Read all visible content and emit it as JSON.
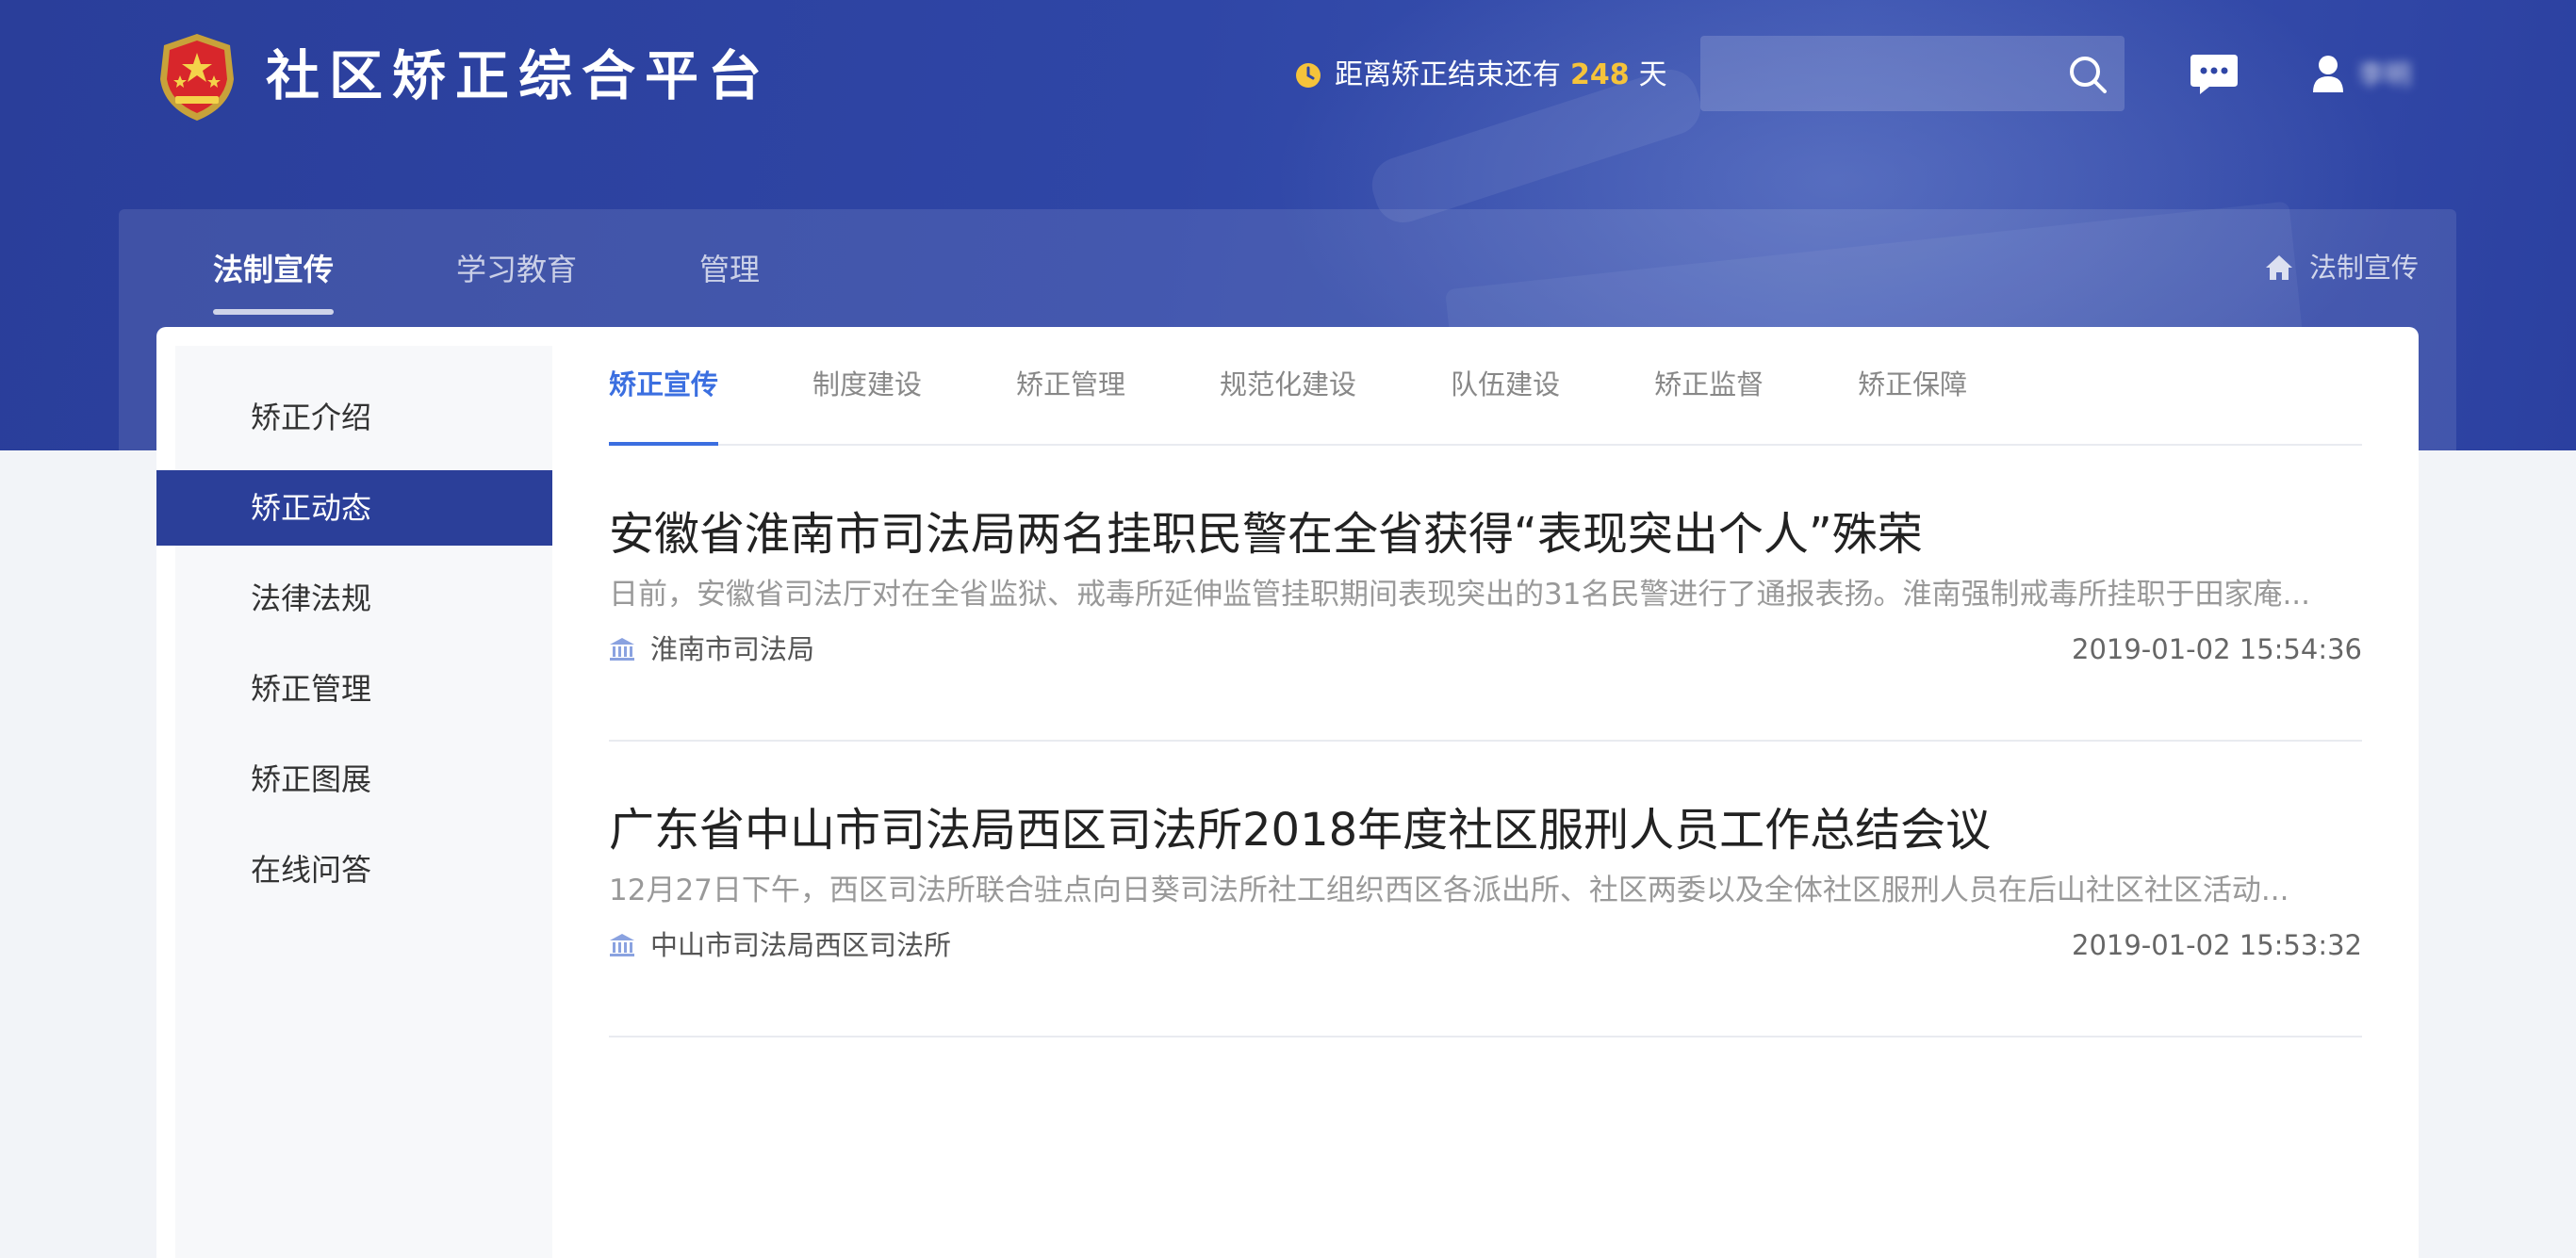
{
  "header": {
    "site_title": "社区矫正综合平台",
    "countdown_prefix": "距离矫正结束还有",
    "countdown_days": "248",
    "countdown_suffix": "天",
    "search_placeholder": "",
    "user_name": "李明"
  },
  "top_nav": [
    {
      "label": "法制宣传",
      "active": true
    },
    {
      "label": "学习教育",
      "active": false
    },
    {
      "label": "管理",
      "active": false
    }
  ],
  "breadcrumb": {
    "current": "法制宣传"
  },
  "sidebar": {
    "items": [
      {
        "label": "矫正介绍",
        "active": false
      },
      {
        "label": "矫正动态",
        "active": true
      },
      {
        "label": "法律法规",
        "active": false
      },
      {
        "label": "矫正管理",
        "active": false
      },
      {
        "label": "矫正图展",
        "active": false
      },
      {
        "label": "在线问答",
        "active": false
      }
    ]
  },
  "sub_tabs": [
    {
      "label": "矫正宣传",
      "active": true
    },
    {
      "label": "制度建设",
      "active": false
    },
    {
      "label": "矫正管理",
      "active": false
    },
    {
      "label": "规范化建设",
      "active": false
    },
    {
      "label": "队伍建设",
      "active": false
    },
    {
      "label": "矫正监督",
      "active": false
    },
    {
      "label": "矫正保障",
      "active": false
    }
  ],
  "articles": [
    {
      "title": "安徽省淮南市司法局两名挂职民警在全省获得“表现突出个人”殊荣",
      "summary": "日前，安徽省司法厅对在全省监狱、戒毒所延伸监管挂职期间表现突出的31名民警进行了通报表扬。淮南强制戒毒所挂职于田家庵...",
      "source": "淮南市司法局",
      "time": "2019-01-02 15:54:36"
    },
    {
      "title": "广东省中山市司法局西区司法所2018年度社区服刑人员工作总结会议",
      "summary": "12月27日下午，西区司法所联合驻点向日葵司法所社工组织西区各派出所、社区两委以及全体社区服刑人员在后山社区社区活动...",
      "source": "中山市司法局西区司法所",
      "time": "2019-01-02 15:53:32"
    }
  ],
  "colors": {
    "banner": "#2f46a6",
    "accent": "#3b6fe0",
    "sidebar_active": "#2b3f99",
    "countdown_highlight": "#f5c33b"
  }
}
